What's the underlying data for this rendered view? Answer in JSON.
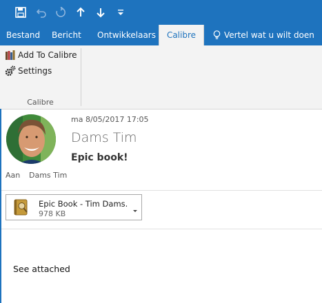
{
  "quick_access": {
    "icons": [
      "save-icon",
      "undo-icon",
      "redo-icon",
      "previous-item-icon",
      "next-item-icon",
      "customize-icon"
    ]
  },
  "ribbon_tabs": [
    {
      "label": "Bestand"
    },
    {
      "label": "Bericht"
    },
    {
      "label": "Ontwikkelaars"
    },
    {
      "label": "Calibre"
    },
    {
      "label": "Vertel wat u wilt doen"
    }
  ],
  "active_tab": "Calibre",
  "ribbon": {
    "buttons": [
      {
        "label": "Add To Calibre",
        "icon": "books-icon"
      },
      {
        "label": "Settings",
        "icon": "gears-icon"
      }
    ],
    "group_label": "Calibre"
  },
  "message": {
    "datetime": "ma 8/05/2017 17:05",
    "sender": "Dams Tim",
    "subject": "Epic book!",
    "to_label": "Aan",
    "to_value": "Dams Tim",
    "attachment": {
      "name": "Epic Book - Tim Dams....",
      "size": "978 KB",
      "icon": "ebook-icon"
    },
    "body": "See attached"
  },
  "colors": {
    "accent": "#1e73be",
    "ribbon_bg": "#f3f3f3"
  }
}
